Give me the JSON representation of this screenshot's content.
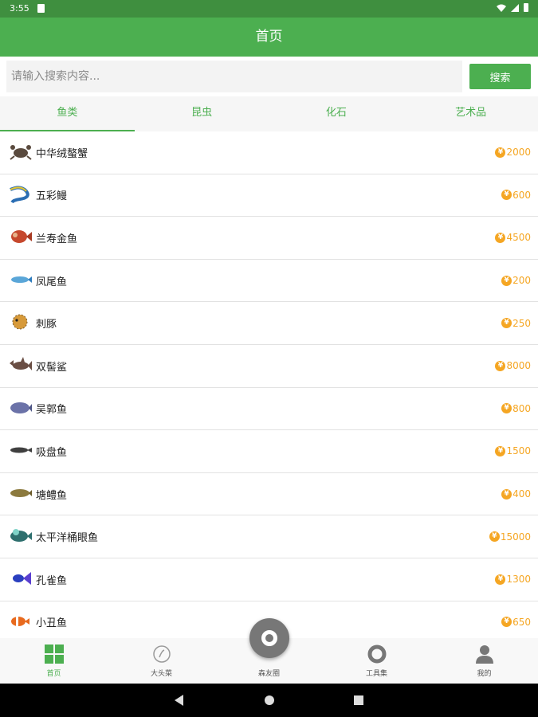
{
  "status": {
    "time": "3:55"
  },
  "appbar": {
    "title": "首页"
  },
  "search": {
    "placeholder": "请输入搜索内容...",
    "button_label": "搜索"
  },
  "tabs": [
    {
      "label": "鱼类",
      "active": true
    },
    {
      "label": "昆虫",
      "active": false
    },
    {
      "label": "化石",
      "active": false
    },
    {
      "label": "艺术品",
      "active": false
    }
  ],
  "items": [
    {
      "name": "中华绒螯蟹",
      "price": "2000",
      "icon": "crab-icon"
    },
    {
      "name": "五彩鳗",
      "price": "600",
      "icon": "eel-icon"
    },
    {
      "name": "兰寿金鱼",
      "price": "4500",
      "icon": "goldfish-icon"
    },
    {
      "name": "凤尾鱼",
      "price": "200",
      "icon": "guppy-icon"
    },
    {
      "name": "刺豚",
      "price": "250",
      "icon": "pufferfish-icon"
    },
    {
      "name": "双髻鲨",
      "price": "8000",
      "icon": "shark-icon"
    },
    {
      "name": "吴郭鱼",
      "price": "800",
      "icon": "tilapia-icon"
    },
    {
      "name": "吸盘鱼",
      "price": "1500",
      "icon": "remora-icon"
    },
    {
      "name": "塘鳢鱼",
      "price": "400",
      "icon": "sleeper-fish-icon"
    },
    {
      "name": "太平洋桶眼鱼",
      "price": "15000",
      "icon": "barreleye-icon"
    },
    {
      "name": "孔雀鱼",
      "price": "1300",
      "icon": "peacock-fish-icon"
    },
    {
      "name": "小丑鱼",
      "price": "650",
      "icon": "clownfish-icon"
    }
  ],
  "coin_symbol": "¥",
  "bottom_nav": [
    {
      "label": "首页",
      "icon": "grid-icon",
      "active": true
    },
    {
      "label": "大头菜",
      "icon": "turnip-icon",
      "active": false
    },
    {
      "label": "森友圈",
      "icon": "ring-icon",
      "active": false
    },
    {
      "label": "工具集",
      "icon": "tools-icon",
      "active": false
    },
    {
      "label": "我的",
      "icon": "person-icon",
      "active": false
    }
  ],
  "colors": {
    "primary": "#4caf50",
    "status_bar": "#3f8f3f",
    "price": "#f5a623"
  }
}
